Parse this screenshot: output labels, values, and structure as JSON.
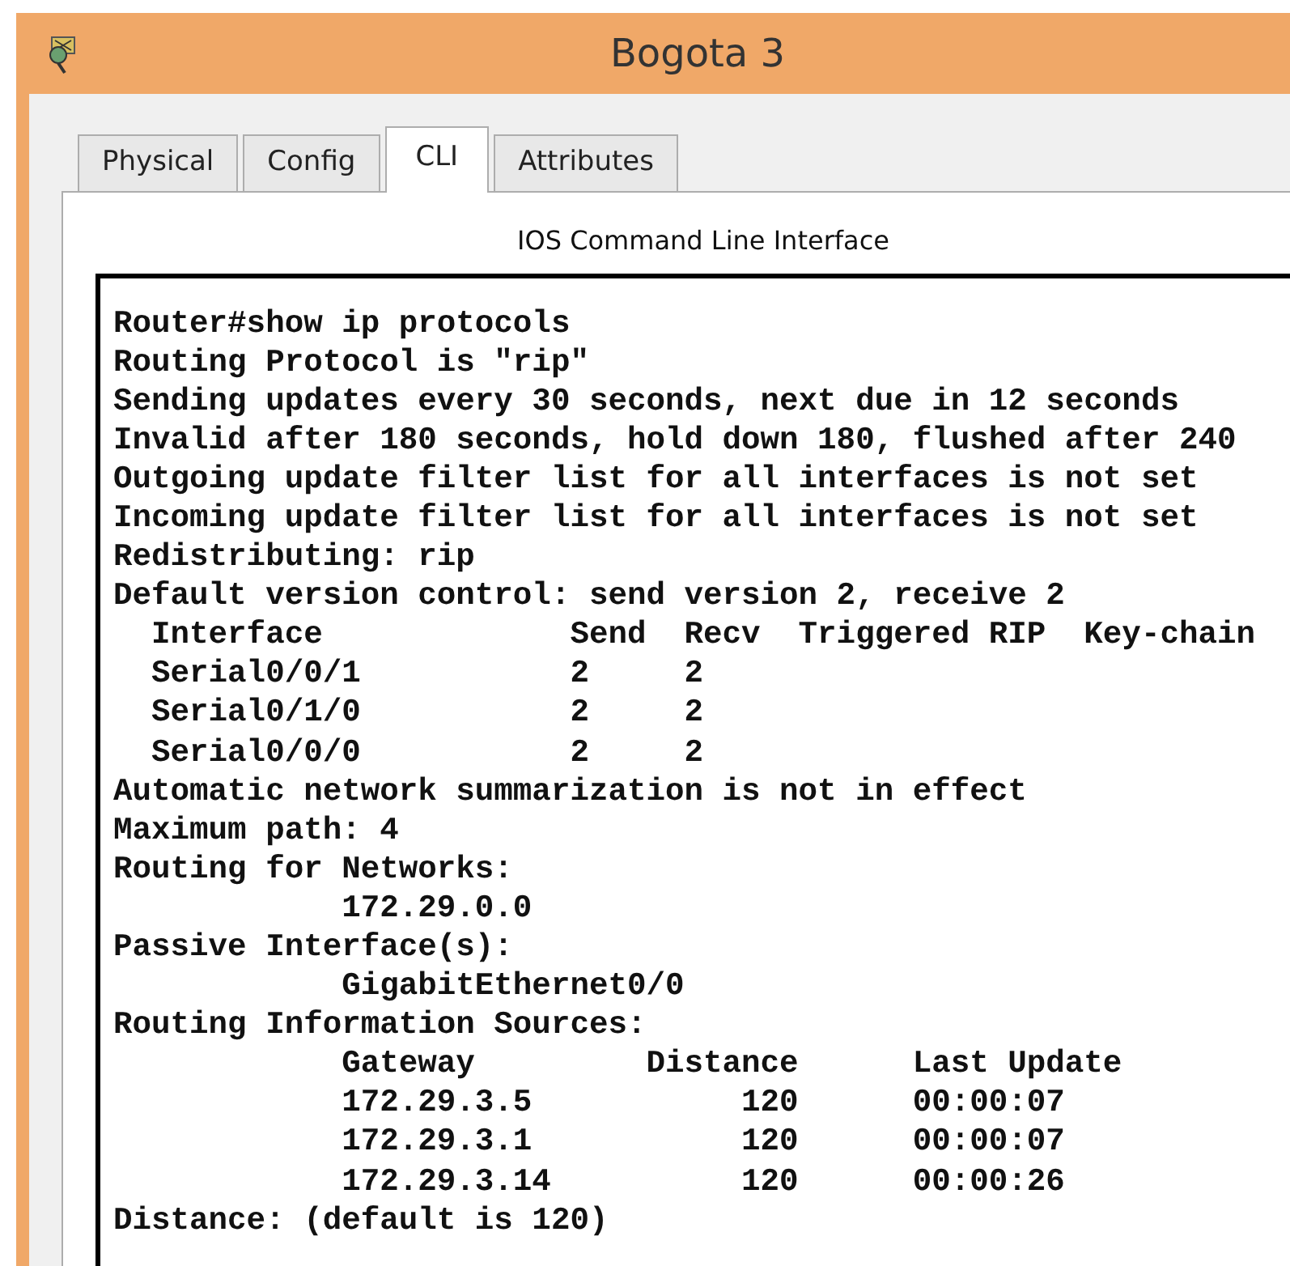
{
  "window": {
    "title": "Bogota 3"
  },
  "tabs": [
    {
      "label": "Physical",
      "selected": false
    },
    {
      "label": "Config",
      "selected": false
    },
    {
      "label": "CLI",
      "selected": true
    },
    {
      "label": "Attributes",
      "selected": false
    }
  ],
  "panel": {
    "heading": "IOS Command Line Interface"
  },
  "terminal": {
    "lines": [
      "Router#show ip protocols",
      "Routing Protocol is \"rip\"",
      "Sending updates every 30 seconds, next due in 12 seconds",
      "Invalid after 180 seconds, hold down 180, flushed after 240",
      "Outgoing update filter list for all interfaces is not set",
      "Incoming update filter list for all interfaces is not set",
      "Redistributing: rip",
      "Default version control: send version 2, receive 2",
      "  Interface             Send  Recv  Triggered RIP  Key-chain",
      "  Serial0/0/1           2     2",
      "  Serial0/1/0           2     2",
      "  Serial0/0/0           2     2",
      "Automatic network summarization is not in effect",
      "Maximum path: 4",
      "Routing for Networks:",
      "            172.29.0.0",
      "Passive Interface(s):",
      "            GigabitEthernet0/0",
      "Routing Information Sources:",
      "            Gateway         Distance      Last Update",
      "            172.29.3.5           120      00:00:07",
      "            172.29.3.1           120      00:00:07",
      "            172.29.3.14          120      00:00:26",
      "Distance: (default is 120)"
    ]
  }
}
